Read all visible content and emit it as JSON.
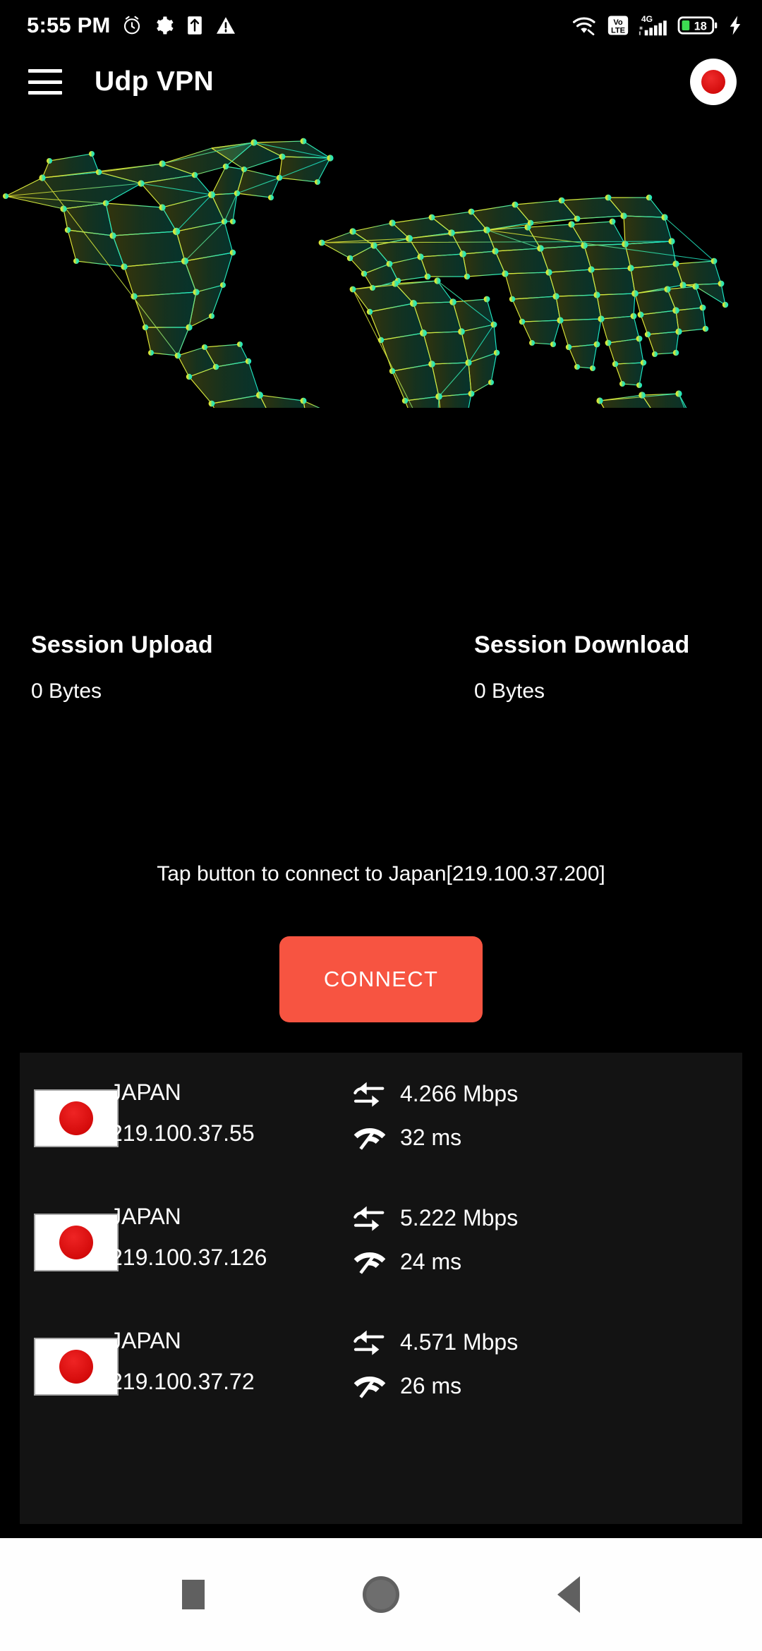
{
  "status_bar": {
    "time": "5:55 PM",
    "left_icons": [
      "alarm-icon",
      "gear-icon",
      "upload-box-icon",
      "warning-icon"
    ],
    "right_icons": [
      "wifi-icon",
      "volte-icon",
      "signal-4g-icon",
      "battery-icon",
      "charging-bolt-icon"
    ],
    "volte_top": "Vo",
    "volte_bottom": "LTE",
    "network_type": "4G",
    "battery_percent": "18"
  },
  "app_bar": {
    "menu_icon": "hamburger-menu-icon",
    "title": "Udp VPN",
    "avatar_icon": "japan-flag-circle-icon"
  },
  "map": {
    "name": "world-map-lowpoly",
    "colors": {
      "west": "#e8e93a",
      "mid": "#63e08a",
      "east": "#22e8c0"
    }
  },
  "session": {
    "upload_label": "Session Upload",
    "upload_value": "0 Bytes",
    "download_label": "Session Download",
    "download_value": "0 Bytes"
  },
  "connect": {
    "hint": "Tap button to connect to Japan[219.100.37.200]",
    "button_label": "CONNECT",
    "button_color": "#f75441"
  },
  "servers": [
    {
      "country": "JAPAN",
      "ip": "219.100.37.55",
      "speed": "4.266 Mbps",
      "ping": "32 ms"
    },
    {
      "country": "JAPAN",
      "ip": "219.100.37.126",
      "speed": "5.222 Mbps",
      "ping": "24 ms"
    },
    {
      "country": "JAPAN",
      "ip": "219.100.37.72",
      "speed": "4.571 Mbps",
      "ping": "26 ms"
    }
  ],
  "nav_bar": {
    "recents": "recents-square-icon",
    "home": "home-circle-icon",
    "back": "back-triangle-icon"
  }
}
